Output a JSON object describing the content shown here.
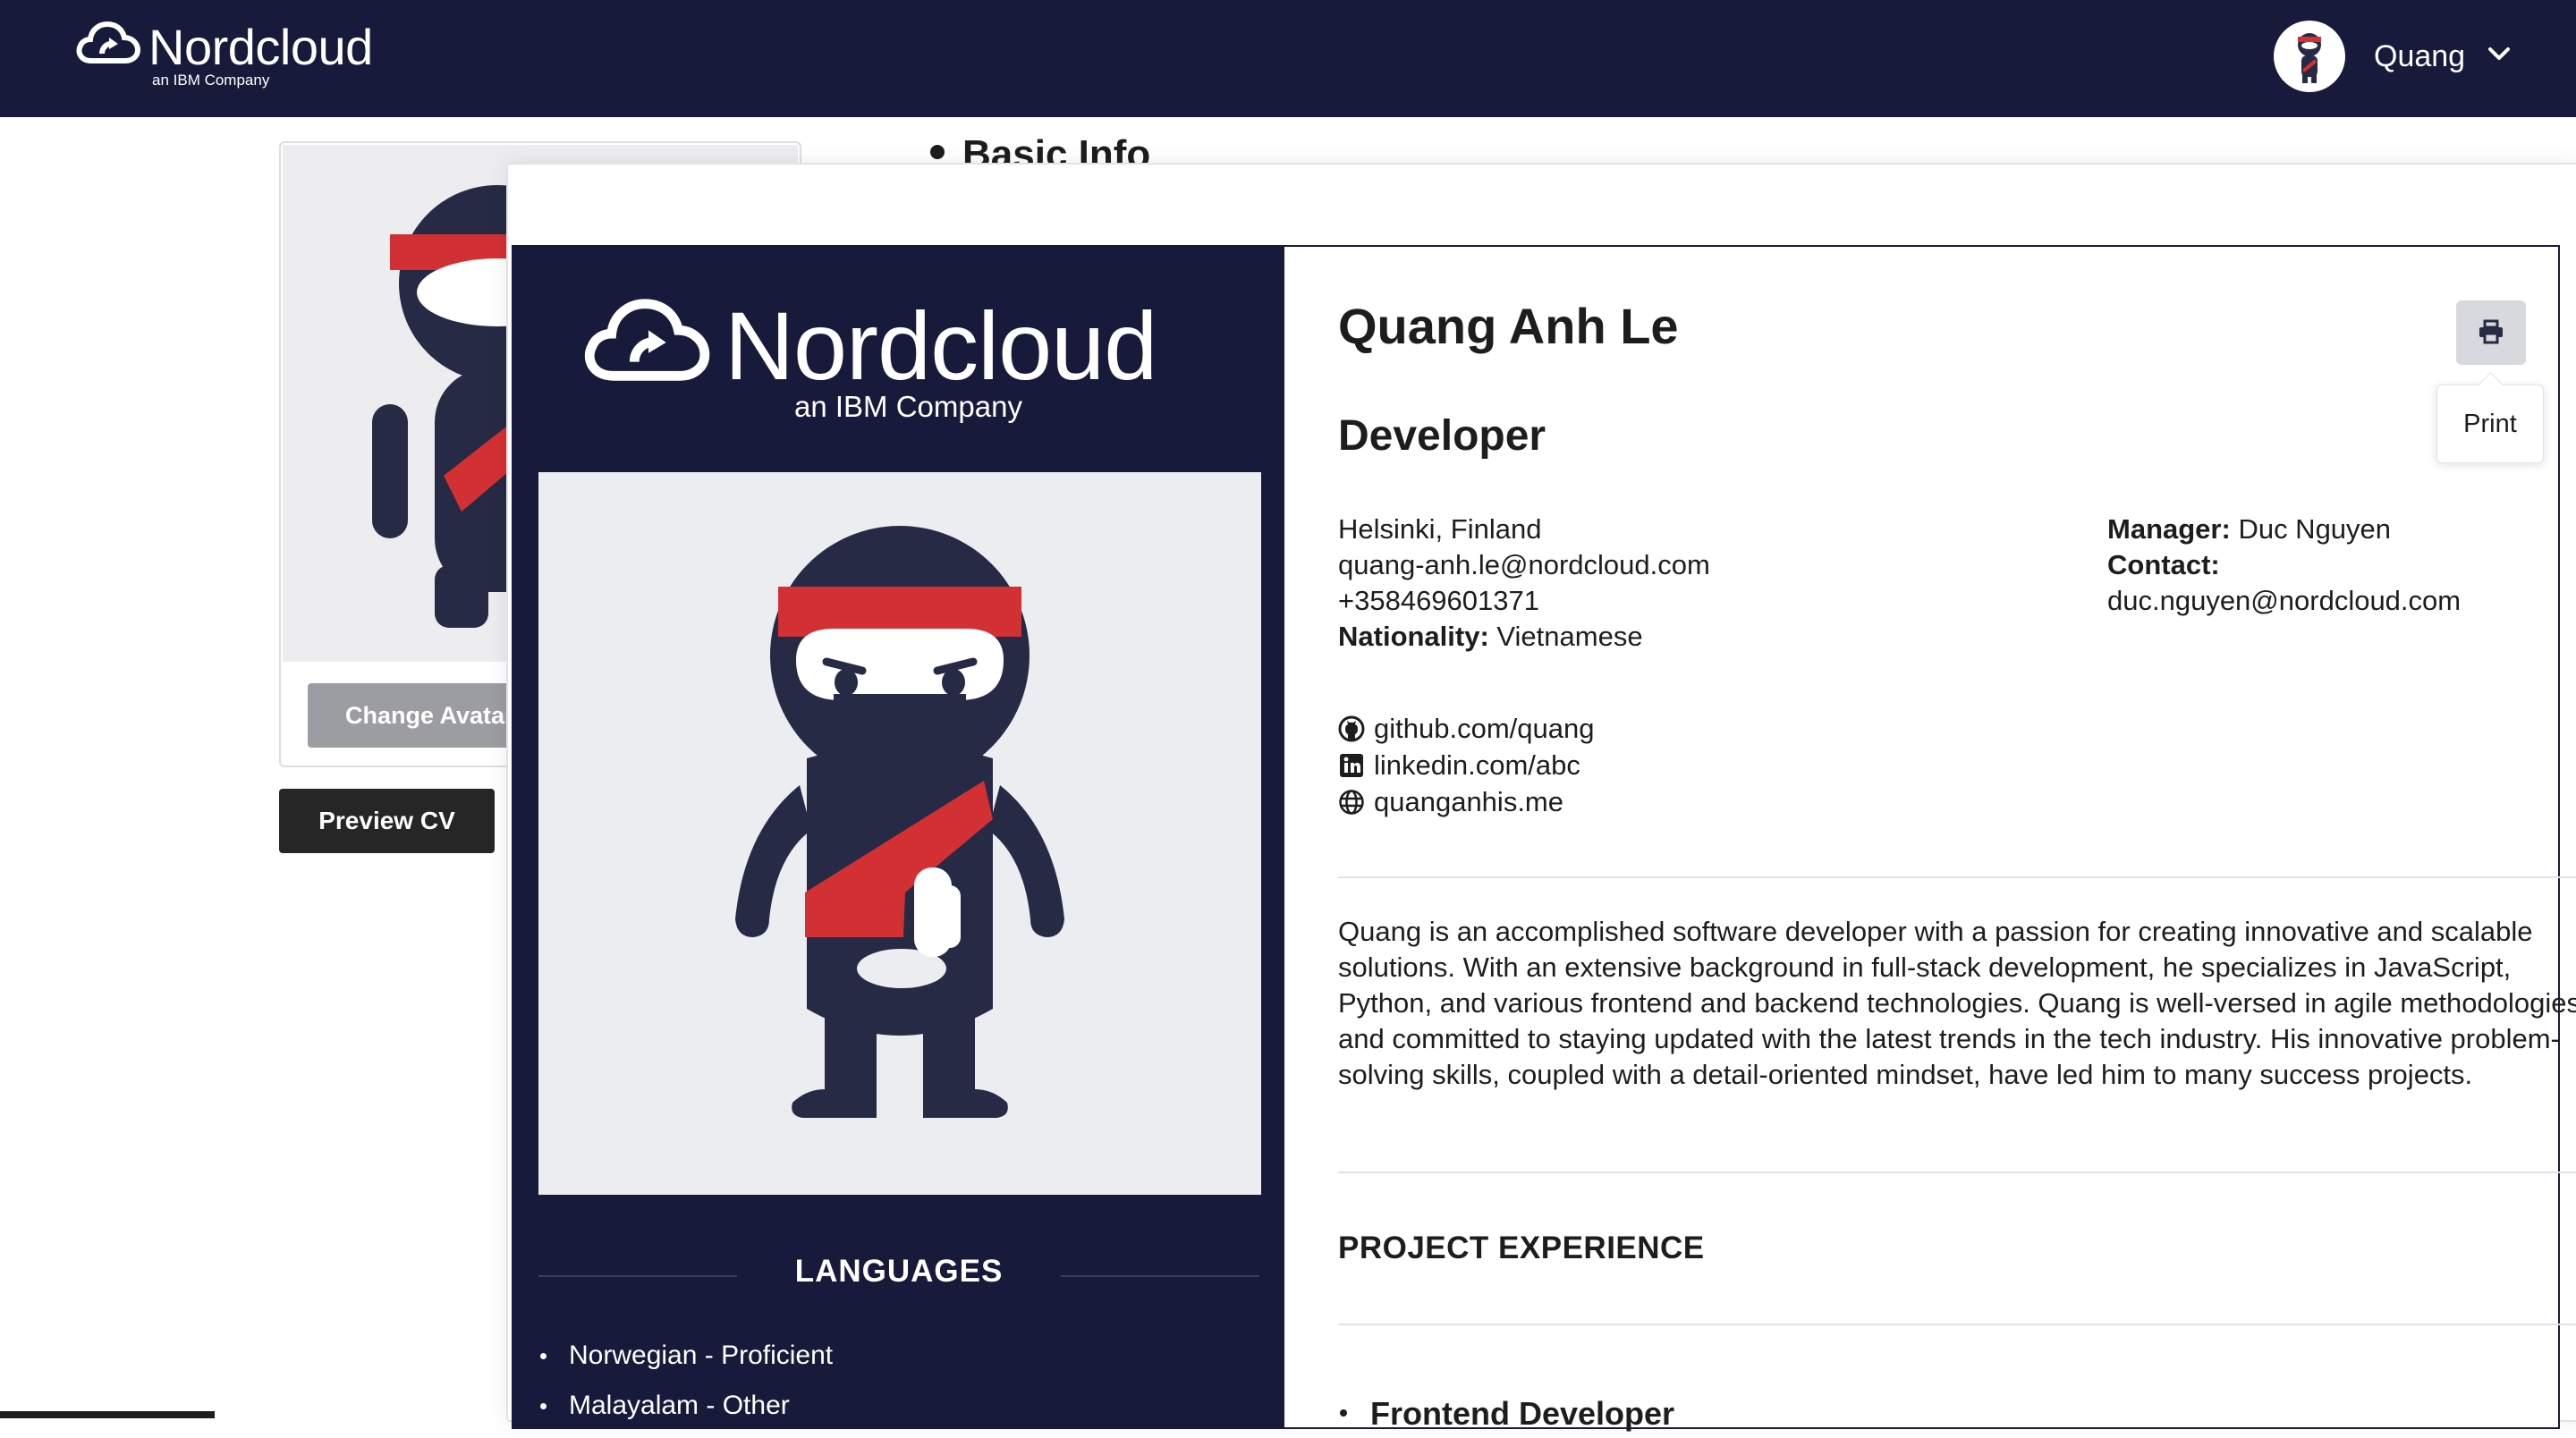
{
  "navbar": {
    "brand_name": "Nordcloud",
    "brand_sub": "an IBM Company",
    "user_name": "Quang",
    "user_avatar_icon": "ninja-avatar",
    "menu_icon": "chevron-down-icon"
  },
  "profile_page": {
    "change_avatar_label": "Change Avatar",
    "preview_cv_label": "Preview CV",
    "section_heading": "Basic Info"
  },
  "cv": {
    "logo_text": "Nordcloud",
    "logo_sub": "an IBM Company",
    "languages_title": "LANGUAGES",
    "languages": [
      "Norwegian - Proficient",
      "Malayalam - Other"
    ],
    "name": "Quang Anh Le",
    "role": "Developer",
    "location": "Helsinki, Finland",
    "email": "quang-anh.le@nordcloud.com",
    "phone": "+358469601371",
    "nationality_label": "Nationality:",
    "nationality": "Vietnamese",
    "manager_label": "Manager:",
    "manager": "Duc Nguyen",
    "contact_label": "Contact:",
    "contact": "duc.nguyen@nordcloud.com",
    "links": {
      "github": "github.com/quang",
      "linkedin": "linkedin.com/abc",
      "website": "quanganhis.me"
    },
    "summary": "Quang is an accomplished software developer with a passion for creating innovative and scalable solutions. With an extensive background in full-stack development, he specializes in JavaScript, Python, and various frontend and backend technologies. Quang is well-versed in agile methodologies and committed to staying updated with the latest trends in the tech industry. His innovative problem-solving skills, coupled with a detail-oriented mindset, have led him to many success projects.",
    "project_experience_title": "PROJECT EXPERIENCE",
    "projects": [
      "Frontend Developer"
    ],
    "print_label": "Print"
  },
  "colors": {
    "navy": "#171a3a",
    "ninja_red": "#d33034",
    "ninja_body": "#262a45"
  }
}
